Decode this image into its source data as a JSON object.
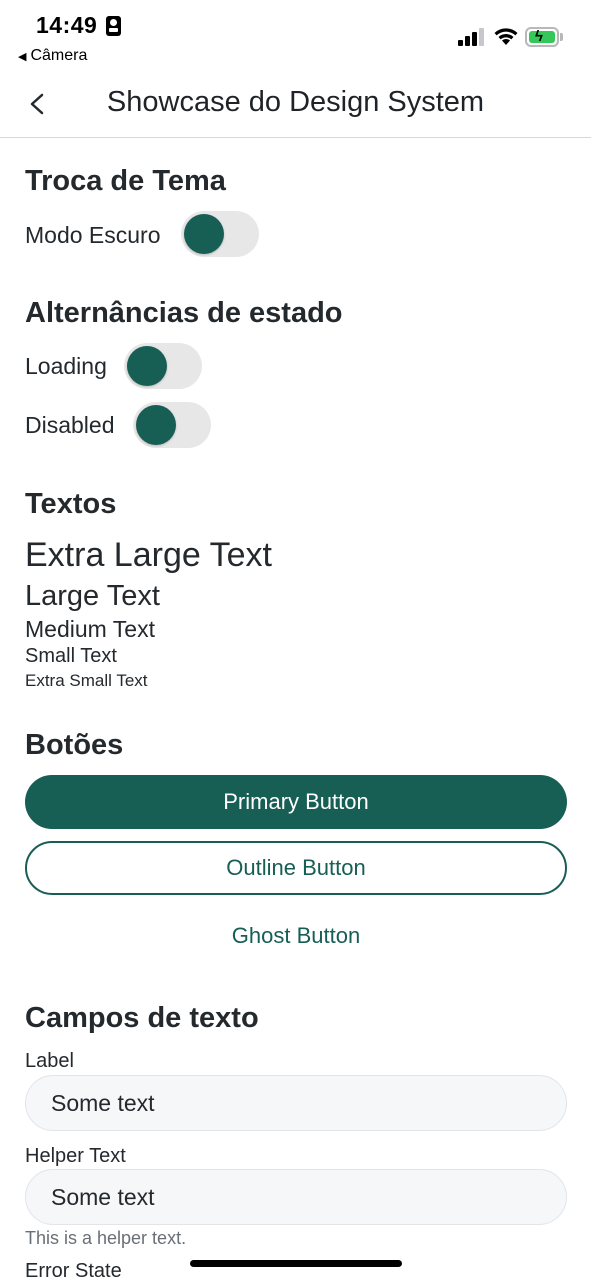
{
  "status_bar": {
    "time": "14:49",
    "back_app": "Câmera",
    "battery_color": "#34c759"
  },
  "header": {
    "title": "Showcase do Design System",
    "back_icon": "chevron-left-icon"
  },
  "theme_section": {
    "title": "Troca de Tema",
    "dark_mode_label": "Modo Escuro"
  },
  "state_section": {
    "title": "Alternâncias de estado",
    "loading_label": "Loading",
    "disabled_label": "Disabled"
  },
  "texts_section": {
    "title": "Textos",
    "extra_large": "Extra Large Text",
    "large": "Large Text",
    "medium": "Medium Text",
    "small": "Small Text",
    "extra_small": "Extra Small Text"
  },
  "buttons_section": {
    "title": "Botões",
    "primary": "Primary Button",
    "outline": "Outline Button",
    "ghost": "Ghost Button"
  },
  "fields_section": {
    "title": "Campos de texto",
    "field1_label": "Label",
    "field1_value": "Some text",
    "field2_label": "Helper Text",
    "field2_value": "Some text",
    "field2_helper": "This is a helper text.",
    "field3_label": "Error State"
  },
  "colors": {
    "brand": "#175e55",
    "toggle_track": "#e7e7e7"
  }
}
